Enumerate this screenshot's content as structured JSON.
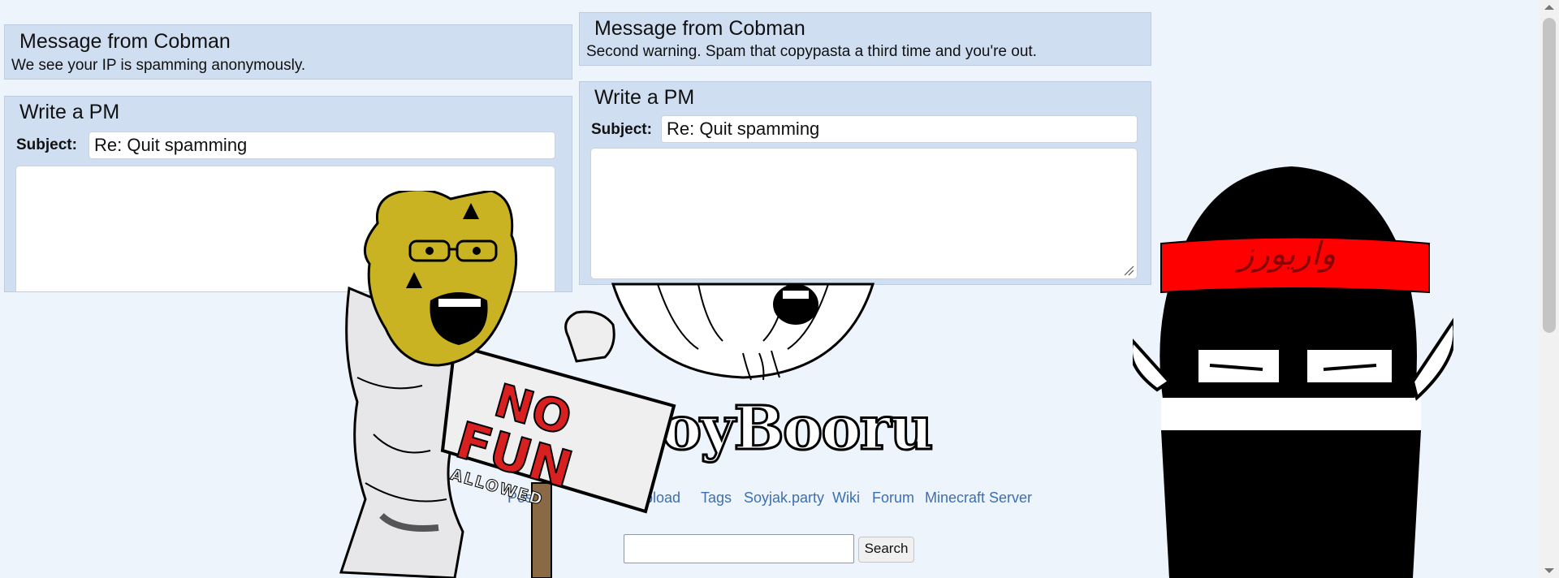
{
  "left_message": {
    "title": "Message from Cobman",
    "body": "We see your IP is spamming anonymously."
  },
  "left_pm": {
    "title": "Write a PM",
    "subject_label": "Subject:",
    "subject_value": "Re: Quit spamming"
  },
  "right_message": {
    "title": "Message from Cobman",
    "body": "Second warning. Spam that copypasta a third time and you're out."
  },
  "right_pm": {
    "title": "Write a PM",
    "subject_label": "Subject:",
    "subject_value": "Re: Quit spamming"
  },
  "logo": {
    "text": "oyBooru"
  },
  "nav": {
    "items": [
      "Pos",
      "pload",
      "Tags",
      "Soyjak.party",
      "Wiki",
      "Forum",
      "Minecraft Server"
    ]
  },
  "search": {
    "button_label": "Search",
    "value": ""
  },
  "sign": {
    "line1": "NO",
    "line2": "FUN",
    "line3": "ALLOWED"
  },
  "headband": {
    "text": "واريورز"
  },
  "colors": {
    "page_bg": "#eef4fc",
    "panel_bg": "#cfdef1",
    "link": "#3d6fb0",
    "headband": "#ff0000",
    "sign_text": "#d92020"
  }
}
